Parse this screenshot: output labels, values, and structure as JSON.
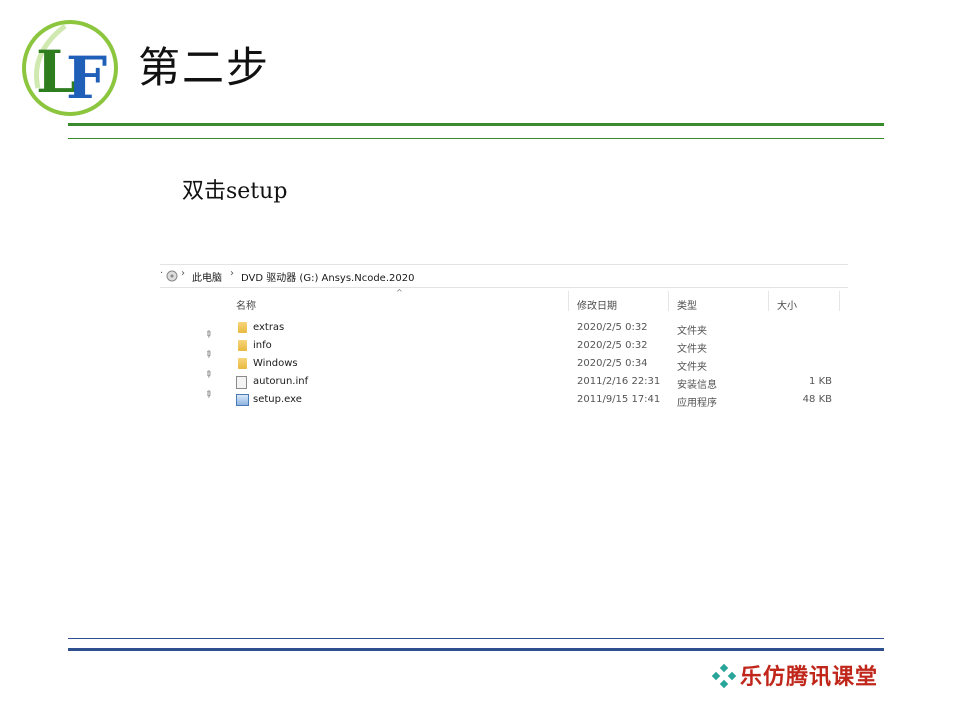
{
  "slide": {
    "title": "第二步",
    "instruction": "双击setup",
    "footer_brand": "乐仿腾讯课堂"
  },
  "logo": {
    "letters": "LF",
    "colors": {
      "l": "#2e7d1f",
      "f": "#1f5fb8",
      "swoosh": "#8cc63f"
    }
  },
  "explorer": {
    "address": {
      "segments": [
        "此电脑",
        "DVD 驱动器 (G:) Ansys.Ncode.2020"
      ]
    },
    "columns": {
      "name": "名称",
      "date": "修改日期",
      "type": "类型",
      "size": "大小"
    },
    "files": [
      {
        "icon": "folder-icon",
        "name": "extras",
        "date": "2020/2/5 0:32",
        "type": "文件夹",
        "size": ""
      },
      {
        "icon": "folder-icon",
        "name": "info",
        "date": "2020/2/5 0:32",
        "type": "文件夹",
        "size": ""
      },
      {
        "icon": "folder-icon",
        "name": "Windows",
        "date": "2020/2/5 0:34",
        "type": "文件夹",
        "size": ""
      },
      {
        "icon": "inf-file-icon",
        "name": "autorun.inf",
        "date": "2011/2/16 22:31",
        "type": "安装信息",
        "size": "1 KB"
      },
      {
        "icon": "exe-file-icon",
        "name": "setup.exe",
        "date": "2011/9/15 17:41",
        "type": "应用程序",
        "size": "48 KB"
      }
    ]
  },
  "colors": {
    "header_rule": "#3a8a2e",
    "footer_rule": "#2f4f8f",
    "brand_text": "#c0261a"
  }
}
